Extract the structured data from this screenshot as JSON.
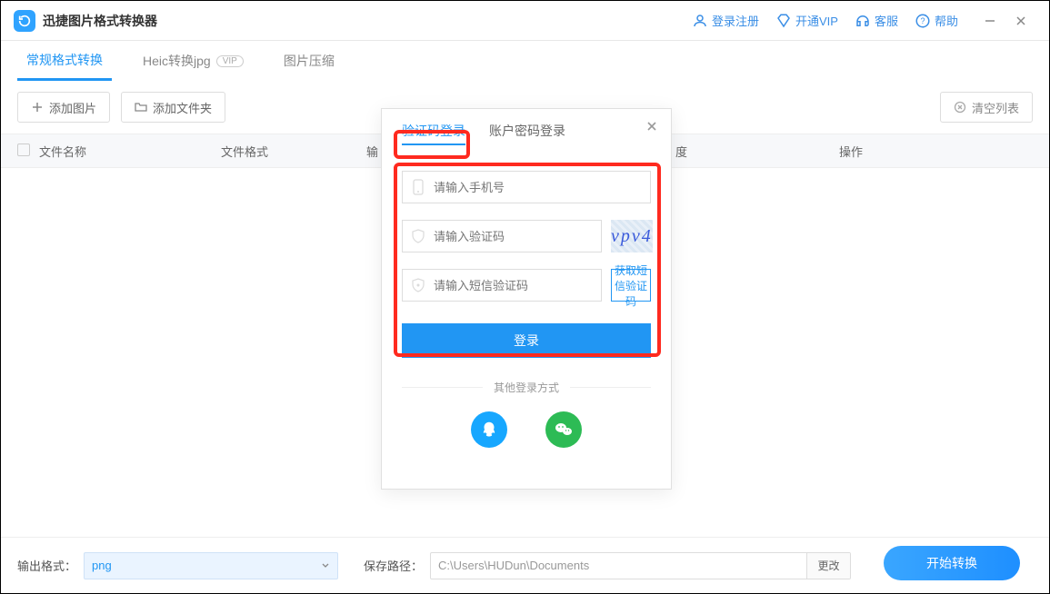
{
  "app": {
    "title": "迅捷图片格式转换器"
  },
  "topActions": {
    "login": "登录注册",
    "vip": "开通VIP",
    "service": "客服",
    "help": "帮助"
  },
  "mainTabs": {
    "common": "常规格式转换",
    "heic": "Heic转换jpg",
    "vipBadge": "VIP",
    "compress": "图片压缩"
  },
  "toolbar": {
    "addImage": "添加图片",
    "addFolder": "添加文件夹",
    "clearList": "清空列表"
  },
  "tableHead": {
    "fileName": "文件名称",
    "fileFormat": "文件格式",
    "output": "输",
    "progress": "度",
    "action": "操作"
  },
  "footer": {
    "outFormatLabel": "输出格式：",
    "outFormatValue": "png",
    "savePathLabel": "保存路径：",
    "savePathValue": "C:\\Users\\HUDun\\Documents",
    "changeLabel": "更改",
    "startLabel": "开始转换"
  },
  "login": {
    "tabCode": "验证码登录",
    "tabPassword": "账户密码登录",
    "phonePh": "请输入手机号",
    "captchaPh": "请输入验证码",
    "captchaText": "vpv4",
    "smsPh": "请输入短信验证码",
    "smsBtn": "获取短信验证码",
    "loginBtn": "登录",
    "otherLabel": "其他登录方式"
  }
}
